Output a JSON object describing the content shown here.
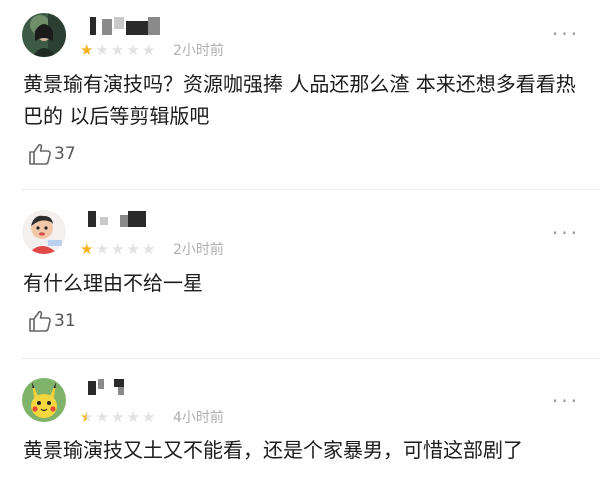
{
  "comments": [
    {
      "avatar_icon": "user-avatar-portrait",
      "rating": 1,
      "rating_max": 5,
      "time": "2小时前",
      "text": "黄景瑜有演技吗？资源咖强捧 人品还那么渣 本来还想多看看热巴的 以后等剪辑版吧",
      "likes": "37"
    },
    {
      "avatar_icon": "user-avatar-cartoon",
      "rating": 1,
      "rating_max": 5,
      "time": "2小时前",
      "text": "有什么理由不给一星",
      "likes": "31"
    },
    {
      "avatar_icon": "user-avatar-pikachu",
      "rating": 0.5,
      "rating_max": 5,
      "time": "4小时前",
      "text": "黄景瑜演技又土又不能看，还是个家暴男，可惜这部剧了"
    }
  ],
  "icons": {
    "more": "more-dots-icon",
    "like": "thumbs-up-icon",
    "star": "star-icon"
  },
  "colors": {
    "star_active": "#f6b321",
    "star_inactive": "#e2e2e2",
    "meta_text": "#b0b0b0"
  }
}
